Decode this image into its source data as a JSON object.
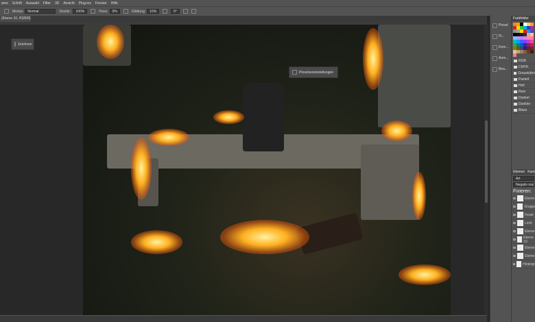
{
  "menu": [
    "ame",
    "Schrift",
    "Auswahl",
    "Filter",
    "3D",
    "Ansicht",
    "Plug-ins",
    "Fenster",
    "Hilfe"
  ],
  "options": {
    "mode_label": "Modus:",
    "mode_value": "Normal",
    "opacity_label": "Deckkr.:",
    "opacity_value": "100%",
    "flow_label": "Fluss:",
    "flow_value": "0%",
    "smoothing_label": "Glättung:",
    "smoothing_value": "10%",
    "angle_value": "0°"
  },
  "document_tab": "(Ebene 10, RGB/8) *",
  "floating": {
    "left_panel": "Zeichnen",
    "brush_panel": "Pinselvoreinstellungen"
  },
  "icon_panels": [
    "Pinsel",
    "Pi...",
    "Kom...",
    "Anm...",
    "Bea..."
  ],
  "panel": {
    "tab": "Farbfelder",
    "layers_tab": "Ebenen",
    "layers_tab2": "Kanäle",
    "filter": "Art",
    "blend": "Negativ multiplizieren",
    "lock_label": "Fixieren:"
  },
  "swatch_colors": [
    "#f08a20",
    "#f0a020",
    "#000000",
    "#ffffff",
    "#ffd060",
    "#ff9a30",
    "#e02020",
    "#ffe000",
    "#40c040",
    "#00b0e0",
    "#2040c0",
    "#a030a0",
    "#909090",
    "#a0a0a0",
    "#ffe000",
    "#e02020",
    "#00a0e0",
    "#6040c0",
    "#000000",
    "#101010",
    "#202020",
    "#303030",
    "#f0a080",
    "#ffc0a0",
    "#80c0ff",
    "#a0a0ff",
    "#c080ff",
    "#e080e0",
    "#ff80c0",
    "#ff80a0",
    "#00c0c0",
    "#00a0ff",
    "#4060ff",
    "#8040ff",
    "#c040c0",
    "#ff40a0",
    "#40a040",
    "#008080",
    "#0060c0",
    "#4020a0",
    "#802080",
    "#c02060",
    "#808000",
    "#606000",
    "#404080",
    "#302060",
    "#602040",
    "#802020",
    "#e0c0a0",
    "#c0a080",
    "#a08060",
    "#806040",
    "#604020",
    "#402010",
    "#f08080"
  ],
  "swatch_folders": [
    "RGB",
    "CMYK",
    "Graustufen",
    "Pastell",
    "Hell",
    "Rein",
    "Dunkel",
    "Dunkler",
    "Blass"
  ],
  "layers": [
    "Ebene",
    "Gruppe",
    "Feuer",
    "Licht",
    "Ebene",
    "Ebene 10",
    "Ebene",
    "Ebene",
    "Hintergr."
  ]
}
